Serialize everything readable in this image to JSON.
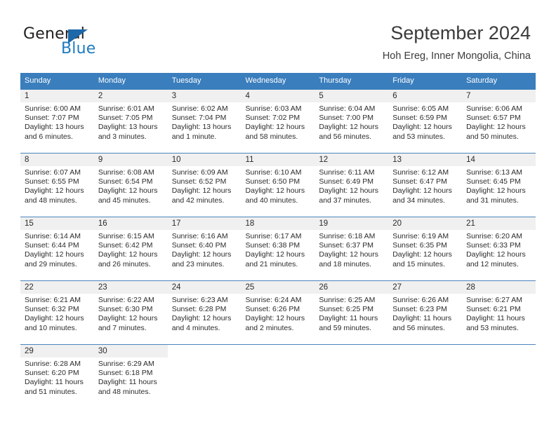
{
  "brand": {
    "word1": "General",
    "word2": "Blue",
    "logo_icon": "triangle-flag-icon",
    "accent_color": "#1c68a8"
  },
  "header": {
    "title": "September 2024",
    "subtitle": "Hoh Ereg, Inner Mongolia, China"
  },
  "calendar": {
    "header_bg": "#3a7ebd",
    "daynum_bg": "#f0f0f0",
    "weekday_headers": [
      "Sunday",
      "Monday",
      "Tuesday",
      "Wednesday",
      "Thursday",
      "Friday",
      "Saturday"
    ],
    "weeks": [
      [
        {
          "day": "1",
          "sunrise": "Sunrise: 6:00 AM",
          "sunset": "Sunset: 7:07 PM",
          "daylight1": "Daylight: 13 hours",
          "daylight2": "and 6 minutes."
        },
        {
          "day": "2",
          "sunrise": "Sunrise: 6:01 AM",
          "sunset": "Sunset: 7:05 PM",
          "daylight1": "Daylight: 13 hours",
          "daylight2": "and 3 minutes."
        },
        {
          "day": "3",
          "sunrise": "Sunrise: 6:02 AM",
          "sunset": "Sunset: 7:04 PM",
          "daylight1": "Daylight: 13 hours",
          "daylight2": "and 1 minute."
        },
        {
          "day": "4",
          "sunrise": "Sunrise: 6:03 AM",
          "sunset": "Sunset: 7:02 PM",
          "daylight1": "Daylight: 12 hours",
          "daylight2": "and 58 minutes."
        },
        {
          "day": "5",
          "sunrise": "Sunrise: 6:04 AM",
          "sunset": "Sunset: 7:00 PM",
          "daylight1": "Daylight: 12 hours",
          "daylight2": "and 56 minutes."
        },
        {
          "day": "6",
          "sunrise": "Sunrise: 6:05 AM",
          "sunset": "Sunset: 6:59 PM",
          "daylight1": "Daylight: 12 hours",
          "daylight2": "and 53 minutes."
        },
        {
          "day": "7",
          "sunrise": "Sunrise: 6:06 AM",
          "sunset": "Sunset: 6:57 PM",
          "daylight1": "Daylight: 12 hours",
          "daylight2": "and 50 minutes."
        }
      ],
      [
        {
          "day": "8",
          "sunrise": "Sunrise: 6:07 AM",
          "sunset": "Sunset: 6:55 PM",
          "daylight1": "Daylight: 12 hours",
          "daylight2": "and 48 minutes."
        },
        {
          "day": "9",
          "sunrise": "Sunrise: 6:08 AM",
          "sunset": "Sunset: 6:54 PM",
          "daylight1": "Daylight: 12 hours",
          "daylight2": "and 45 minutes."
        },
        {
          "day": "10",
          "sunrise": "Sunrise: 6:09 AM",
          "sunset": "Sunset: 6:52 PM",
          "daylight1": "Daylight: 12 hours",
          "daylight2": "and 42 minutes."
        },
        {
          "day": "11",
          "sunrise": "Sunrise: 6:10 AM",
          "sunset": "Sunset: 6:50 PM",
          "daylight1": "Daylight: 12 hours",
          "daylight2": "and 40 minutes."
        },
        {
          "day": "12",
          "sunrise": "Sunrise: 6:11 AM",
          "sunset": "Sunset: 6:49 PM",
          "daylight1": "Daylight: 12 hours",
          "daylight2": "and 37 minutes."
        },
        {
          "day": "13",
          "sunrise": "Sunrise: 6:12 AM",
          "sunset": "Sunset: 6:47 PM",
          "daylight1": "Daylight: 12 hours",
          "daylight2": "and 34 minutes."
        },
        {
          "day": "14",
          "sunrise": "Sunrise: 6:13 AM",
          "sunset": "Sunset: 6:45 PM",
          "daylight1": "Daylight: 12 hours",
          "daylight2": "and 31 minutes."
        }
      ],
      [
        {
          "day": "15",
          "sunrise": "Sunrise: 6:14 AM",
          "sunset": "Sunset: 6:44 PM",
          "daylight1": "Daylight: 12 hours",
          "daylight2": "and 29 minutes."
        },
        {
          "day": "16",
          "sunrise": "Sunrise: 6:15 AM",
          "sunset": "Sunset: 6:42 PM",
          "daylight1": "Daylight: 12 hours",
          "daylight2": "and 26 minutes."
        },
        {
          "day": "17",
          "sunrise": "Sunrise: 6:16 AM",
          "sunset": "Sunset: 6:40 PM",
          "daylight1": "Daylight: 12 hours",
          "daylight2": "and 23 minutes."
        },
        {
          "day": "18",
          "sunrise": "Sunrise: 6:17 AM",
          "sunset": "Sunset: 6:38 PM",
          "daylight1": "Daylight: 12 hours",
          "daylight2": "and 21 minutes."
        },
        {
          "day": "19",
          "sunrise": "Sunrise: 6:18 AM",
          "sunset": "Sunset: 6:37 PM",
          "daylight1": "Daylight: 12 hours",
          "daylight2": "and 18 minutes."
        },
        {
          "day": "20",
          "sunrise": "Sunrise: 6:19 AM",
          "sunset": "Sunset: 6:35 PM",
          "daylight1": "Daylight: 12 hours",
          "daylight2": "and 15 minutes."
        },
        {
          "day": "21",
          "sunrise": "Sunrise: 6:20 AM",
          "sunset": "Sunset: 6:33 PM",
          "daylight1": "Daylight: 12 hours",
          "daylight2": "and 12 minutes."
        }
      ],
      [
        {
          "day": "22",
          "sunrise": "Sunrise: 6:21 AM",
          "sunset": "Sunset: 6:32 PM",
          "daylight1": "Daylight: 12 hours",
          "daylight2": "and 10 minutes."
        },
        {
          "day": "23",
          "sunrise": "Sunrise: 6:22 AM",
          "sunset": "Sunset: 6:30 PM",
          "daylight1": "Daylight: 12 hours",
          "daylight2": "and 7 minutes."
        },
        {
          "day": "24",
          "sunrise": "Sunrise: 6:23 AM",
          "sunset": "Sunset: 6:28 PM",
          "daylight1": "Daylight: 12 hours",
          "daylight2": "and 4 minutes."
        },
        {
          "day": "25",
          "sunrise": "Sunrise: 6:24 AM",
          "sunset": "Sunset: 6:26 PM",
          "daylight1": "Daylight: 12 hours",
          "daylight2": "and 2 minutes."
        },
        {
          "day": "26",
          "sunrise": "Sunrise: 6:25 AM",
          "sunset": "Sunset: 6:25 PM",
          "daylight1": "Daylight: 11 hours",
          "daylight2": "and 59 minutes."
        },
        {
          "day": "27",
          "sunrise": "Sunrise: 6:26 AM",
          "sunset": "Sunset: 6:23 PM",
          "daylight1": "Daylight: 11 hours",
          "daylight2": "and 56 minutes."
        },
        {
          "day": "28",
          "sunrise": "Sunrise: 6:27 AM",
          "sunset": "Sunset: 6:21 PM",
          "daylight1": "Daylight: 11 hours",
          "daylight2": "and 53 minutes."
        }
      ],
      [
        {
          "day": "29",
          "sunrise": "Sunrise: 6:28 AM",
          "sunset": "Sunset: 6:20 PM",
          "daylight1": "Daylight: 11 hours",
          "daylight2": "and 51 minutes."
        },
        {
          "day": "30",
          "sunrise": "Sunrise: 6:29 AM",
          "sunset": "Sunset: 6:18 PM",
          "daylight1": "Daylight: 11 hours",
          "daylight2": "and 48 minutes."
        },
        {
          "day": "",
          "sunrise": "",
          "sunset": "",
          "daylight1": "",
          "daylight2": ""
        },
        {
          "day": "",
          "sunrise": "",
          "sunset": "",
          "daylight1": "",
          "daylight2": ""
        },
        {
          "day": "",
          "sunrise": "",
          "sunset": "",
          "daylight1": "",
          "daylight2": ""
        },
        {
          "day": "",
          "sunrise": "",
          "sunset": "",
          "daylight1": "",
          "daylight2": ""
        },
        {
          "day": "",
          "sunrise": "",
          "sunset": "",
          "daylight1": "",
          "daylight2": ""
        }
      ]
    ]
  }
}
